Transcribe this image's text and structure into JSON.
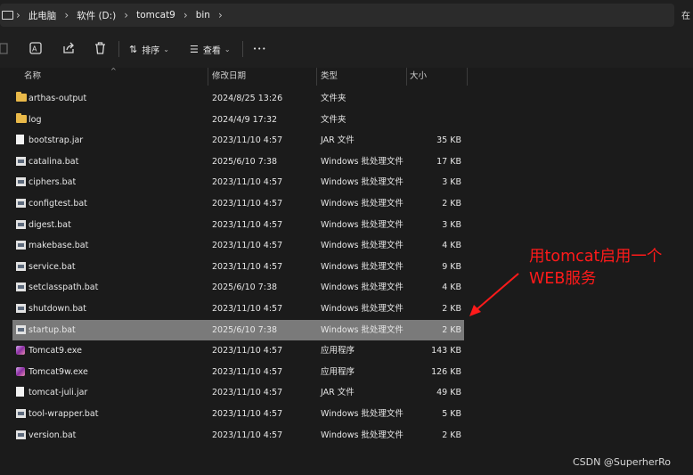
{
  "breadcrumb": [
    "此电脑",
    "软件 (D:)",
    "tomcat9",
    "bin"
  ],
  "truncated_right_char": "在",
  "toolbar": {
    "sort_label": "排序",
    "view_label": "查看",
    "more_label": "•••"
  },
  "columns": {
    "name": "名称",
    "date": "修改日期",
    "type": "类型",
    "size": "大小"
  },
  "rows": [
    {
      "name": "arthas-output",
      "date": "2024/8/25 13:26",
      "type": "文件夹",
      "size": "",
      "icon": "folder"
    },
    {
      "name": "log",
      "date": "2024/4/9 17:32",
      "type": "文件夹",
      "size": "",
      "icon": "folder"
    },
    {
      "name": "bootstrap.jar",
      "date": "2023/11/10 4:57",
      "type": "JAR 文件",
      "size": "35 KB",
      "icon": "jar"
    },
    {
      "name": "catalina.bat",
      "date": "2025/6/10 7:38",
      "type": "Windows 批处理文件",
      "size": "17 KB",
      "icon": "bat"
    },
    {
      "name": "ciphers.bat",
      "date": "2023/11/10 4:57",
      "type": "Windows 批处理文件",
      "size": "3 KB",
      "icon": "bat"
    },
    {
      "name": "configtest.bat",
      "date": "2023/11/10 4:57",
      "type": "Windows 批处理文件",
      "size": "2 KB",
      "icon": "bat"
    },
    {
      "name": "digest.bat",
      "date": "2023/11/10 4:57",
      "type": "Windows 批处理文件",
      "size": "3 KB",
      "icon": "bat"
    },
    {
      "name": "makebase.bat",
      "date": "2023/11/10 4:57",
      "type": "Windows 批处理文件",
      "size": "4 KB",
      "icon": "bat"
    },
    {
      "name": "service.bat",
      "date": "2023/11/10 4:57",
      "type": "Windows 批处理文件",
      "size": "9 KB",
      "icon": "bat"
    },
    {
      "name": "setclasspath.bat",
      "date": "2025/6/10 7:38",
      "type": "Windows 批处理文件",
      "size": "4 KB",
      "icon": "bat"
    },
    {
      "name": "shutdown.bat",
      "date": "2023/11/10 4:57",
      "type": "Windows 批处理文件",
      "size": "2 KB",
      "icon": "bat"
    },
    {
      "name": "startup.bat",
      "date": "2025/6/10 7:38",
      "type": "Windows 批处理文件",
      "size": "2 KB",
      "icon": "bat",
      "selected": true
    },
    {
      "name": "Tomcat9.exe",
      "date": "2023/11/10 4:57",
      "type": "应用程序",
      "size": "143 KB",
      "icon": "exe"
    },
    {
      "name": "Tomcat9w.exe",
      "date": "2023/11/10 4:57",
      "type": "应用程序",
      "size": "126 KB",
      "icon": "exe"
    },
    {
      "name": "tomcat-juli.jar",
      "date": "2023/11/10 4:57",
      "type": "JAR 文件",
      "size": "49 KB",
      "icon": "jar"
    },
    {
      "name": "tool-wrapper.bat",
      "date": "2023/11/10 4:57",
      "type": "Windows 批处理文件",
      "size": "5 KB",
      "icon": "bat"
    },
    {
      "name": "version.bat",
      "date": "2023/11/10 4:57",
      "type": "Windows 批处理文件",
      "size": "2 KB",
      "icon": "bat"
    }
  ],
  "annotation": {
    "line1": "用tomcat启用一个",
    "line2": "WEB服务",
    "color": "#ff1a1a"
  },
  "watermark": "CSDN @SuperherRo",
  "colors": {
    "selected_row": "#7a7a7a",
    "folder": "#e9b949"
  }
}
